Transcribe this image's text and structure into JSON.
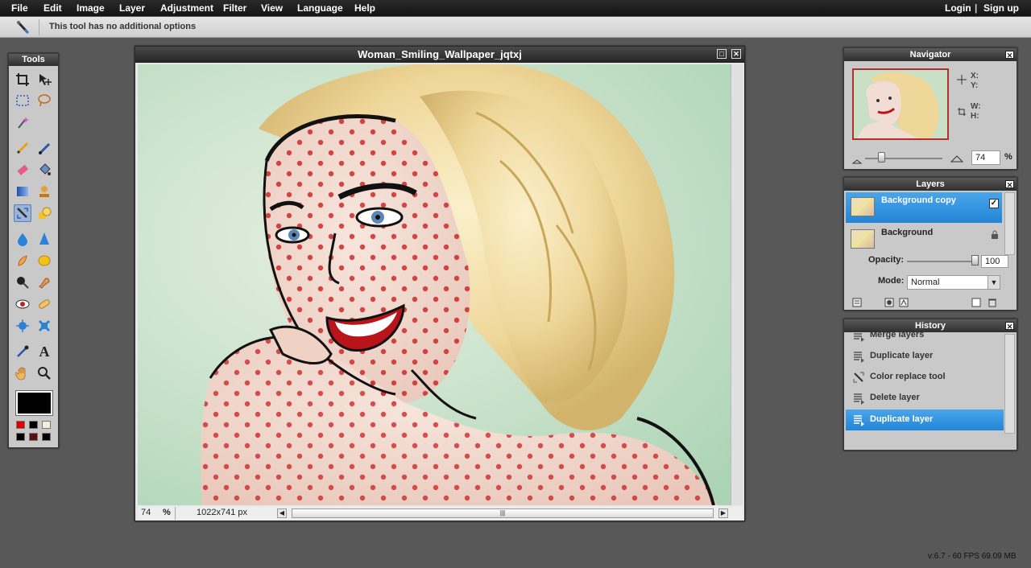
{
  "menubar": {
    "items": [
      "File",
      "Edit",
      "Image",
      "Layer",
      "Adjustment",
      "Filter",
      "View",
      "Language",
      "Help"
    ],
    "login": "Login",
    "separator": "|",
    "signup": "Sign up"
  },
  "options": {
    "message": "This tool has no additional options",
    "tool_icon": "color-replace-tool-icon"
  },
  "tools": {
    "title": "Tools",
    "foreground_color": "#000000",
    "swatches": [
      "#e00000",
      "#000000",
      "#f4edd8",
      "#000000",
      "#5a1010",
      "#000000"
    ]
  },
  "canvas": {
    "title": "Woman_Smiling_Wallpaper_jqtxj",
    "zoom": "74",
    "zoom_unit": "%",
    "dimensions": "1022x741 px"
  },
  "navigator": {
    "title": "Navigator",
    "x_label": "X:",
    "y_label": "Y:",
    "w_label": "W:",
    "h_label": "H:",
    "zoom": "74",
    "zoom_unit": "%"
  },
  "layers": {
    "title": "Layers",
    "items": [
      {
        "name": "Background copy",
        "selected": true,
        "visible": true
      },
      {
        "name": "Background",
        "selected": false,
        "locked": true
      }
    ],
    "opacity_label": "Opacity:",
    "opacity": "100",
    "mode_label": "Mode:",
    "mode": "Normal"
  },
  "history": {
    "title": "History",
    "items": [
      {
        "label": "Merge layers",
        "icon": "layer-icon"
      },
      {
        "label": "Duplicate layer",
        "icon": "layer-icon"
      },
      {
        "label": "Color replace tool",
        "icon": "color-replace-icon"
      },
      {
        "label": "Delete layer",
        "icon": "layer-icon"
      },
      {
        "label": "Duplicate layer",
        "icon": "layer-icon",
        "selected": true
      }
    ]
  },
  "footer": {
    "version": "v:6.7 - 60 FPS 69.09 MB"
  },
  "colors": {
    "accent": "#2385d6",
    "menubar": "#1c1c1c",
    "panel": "#c9c9c9",
    "workspace": "#585858"
  }
}
